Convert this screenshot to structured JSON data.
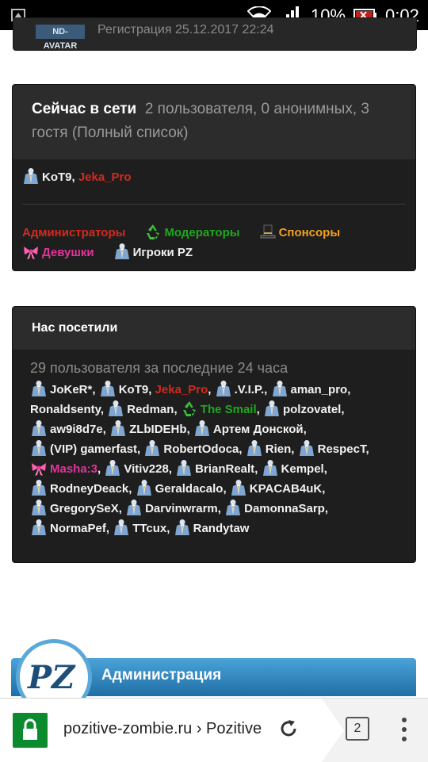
{
  "status_bar": {
    "battery_percent": "10%",
    "time": "0:02"
  },
  "top_card": {
    "avatar_label": "ND-AVATAR",
    "registration": "Регистрация 25.12.2017 22:24"
  },
  "online": {
    "title": "Сейчас в сети",
    "summary": "2 пользователя, 0 анонимных, 3 гостя (Полный список)",
    "users": [
      {
        "name": "KoT9",
        "color": "#f2f2f2",
        "icon": "player-icon"
      },
      {
        "name": "Jeka_Pro",
        "color": "#d42a1e",
        "icon": ""
      }
    ],
    "legend": [
      {
        "label": "Администраторы",
        "color": "#d42a1e",
        "icon": ""
      },
      {
        "label": "Модераторы",
        "color": "#1ea81e",
        "icon": "recycle-icon"
      },
      {
        "label": "Спонсоры",
        "color": "#f0a01e",
        "icon": "top-hat-icon"
      },
      {
        "label": "Девушки",
        "color": "#e0359a",
        "icon": "bow-icon"
      },
      {
        "label": "Игроки PZ",
        "color": "#f2f2f2",
        "icon": "player-icon"
      }
    ]
  },
  "visited": {
    "title": "Нас посетили",
    "count_text": "29 пользователя за последние 24 часа",
    "users": [
      {
        "name": "JoKeR*",
        "color": "#f2f2f2",
        "icon": "player-icon"
      },
      {
        "name": "KoT9",
        "color": "#f2f2f2",
        "icon": "player-icon"
      },
      {
        "name": "Jeka_Pro",
        "color": "#d42a1e",
        "icon": ""
      },
      {
        "name": ".V.I.P.",
        "color": "#f2f2f2",
        "icon": "player-icon"
      },
      {
        "name": "aman_pro",
        "color": "#f2f2f2",
        "icon": "player-icon"
      },
      {
        "name": "Ronaldsenty",
        "color": "#f2f2f2",
        "icon": ""
      },
      {
        "name": "Redman",
        "color": "#f2f2f2",
        "icon": "player-icon"
      },
      {
        "name": "The Smail",
        "color": "#1ea81e",
        "icon": "recycle-icon"
      },
      {
        "name": "polzovatel",
        "color": "#f2f2f2",
        "icon": "player-icon"
      },
      {
        "name": "aw9i8d7e",
        "color": "#f2f2f2",
        "icon": "player-icon"
      },
      {
        "name": "ZLbIDEHb",
        "color": "#f2f2f2",
        "icon": "player-icon"
      },
      {
        "name": "Артем Донской",
        "color": "#f2f2f2",
        "icon": "player-icon"
      },
      {
        "name": "(VIP) gamerfast",
        "color": "#f2f2f2",
        "icon": "player-icon"
      },
      {
        "name": "RobertOdoca",
        "color": "#f2f2f2",
        "icon": "player-icon"
      },
      {
        "name": "Rien",
        "color": "#f2f2f2",
        "icon": "player-icon"
      },
      {
        "name": "RespecT",
        "color": "#f2f2f2",
        "icon": "player-icon"
      },
      {
        "name": "Masha:3",
        "color": "#e0359a",
        "icon": "bow-icon"
      },
      {
        "name": "Vitiv228",
        "color": "#f2f2f2",
        "icon": "player-icon"
      },
      {
        "name": "BrianRealt",
        "color": "#f2f2f2",
        "icon": "player-icon"
      },
      {
        "name": "Kempel",
        "color": "#f2f2f2",
        "icon": "player-icon"
      },
      {
        "name": "RodneyDeack",
        "color": "#f2f2f2",
        "icon": "player-icon"
      },
      {
        "name": "Geraldacalo",
        "color": "#f2f2f2",
        "icon": "player-icon"
      },
      {
        "name": "KPACAB4uK",
        "color": "#f2f2f2",
        "icon": "player-icon"
      },
      {
        "name": "GregorySeX",
        "color": "#f2f2f2",
        "icon": "player-icon"
      },
      {
        "name": "Darvinwrarm",
        "color": "#f2f2f2",
        "icon": "player-icon"
      },
      {
        "name": "DamonnaSarp",
        "color": "#f2f2f2",
        "icon": "player-icon"
      },
      {
        "name": "NormaPef",
        "color": "#f2f2f2",
        "icon": "player-icon"
      },
      {
        "name": "TTcux",
        "color": "#f2f2f2",
        "icon": "player-icon"
      },
      {
        "name": "Randytaw",
        "color": "#f2f2f2",
        "icon": "player-icon"
      }
    ]
  },
  "admin_section": {
    "logo_text": "PZ",
    "title": "Администрация"
  },
  "browser": {
    "url": "pozitive-zombie.ru › Pozitive",
    "tab_count": "2"
  }
}
